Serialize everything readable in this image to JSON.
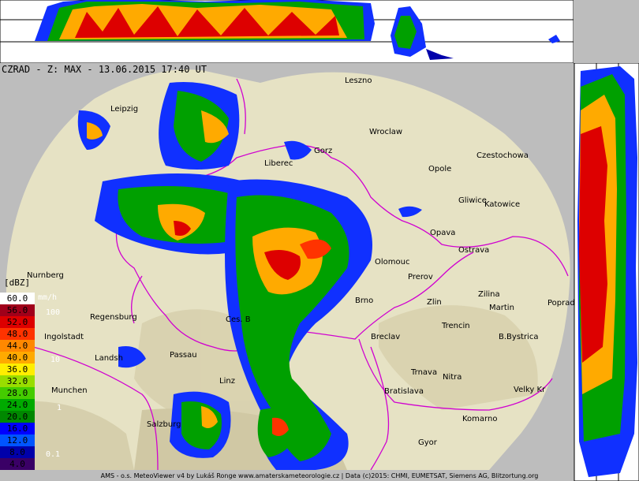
{
  "title": "CZRAD - Z: MAX - 13.06.2015 17:40 UT",
  "legend": {
    "unit": "[dBZ]",
    "rain_unit": "mm/h",
    "levels": [
      {
        "label": "60.0",
        "color": "#ffffff",
        "text": "#000000"
      },
      {
        "label": "56.0",
        "color": "#a0001a",
        "text": "#000000"
      },
      {
        "label": "52.0",
        "color": "#dd0000",
        "text": "#000000"
      },
      {
        "label": "48.0",
        "color": "#ff3300",
        "text": "#000000"
      },
      {
        "label": "44.0",
        "color": "#ff8800",
        "text": "#000000"
      },
      {
        "label": "40.0",
        "color": "#ffaa00",
        "text": "#000000"
      },
      {
        "label": "36.0",
        "color": "#ffee00",
        "text": "#000000"
      },
      {
        "label": "32.0",
        "color": "#99dd00",
        "text": "#000000"
      },
      {
        "label": "28.0",
        "color": "#44cc00",
        "text": "#000000"
      },
      {
        "label": "24.0",
        "color": "#00aa00",
        "text": "#000000"
      },
      {
        "label": "20.0",
        "color": "#008800",
        "text": "#000000"
      },
      {
        "label": "16.0",
        "color": "#0000ff",
        "text": "#000000"
      },
      {
        "label": "12.0",
        "color": "#0055ff",
        "text": "#000000"
      },
      {
        "label": "8.0",
        "color": "#0000aa",
        "text": "#000000"
      },
      {
        "label": "4.0",
        "color": "#3a0066",
        "text": "#000000"
      }
    ],
    "rain_rates": [
      "100",
      "10",
      "1",
      "0.1"
    ]
  },
  "cities": [
    "Leipzig",
    "Leszno",
    "Wroclaw",
    "Gorz",
    "Liberec",
    "Czestochowa",
    "Opole",
    "Gliwice",
    "Katowice",
    "Opava",
    "Ostrava",
    "Olomouc",
    "Prerov",
    "Brno",
    "Zlin",
    "Zilina",
    "Martin",
    "Poprad",
    "Nurnberg",
    "Regensburg",
    "Ingolstadt",
    "Ces. B",
    "Breclav",
    "Trencin",
    "B.Bystrica",
    "Landsh",
    "Passau",
    "Trnava",
    "Nitra",
    "Munchen",
    "Linz",
    "Bratislava",
    "Velky Kr",
    "Salzburg",
    "Komarno",
    "Gyor"
  ],
  "footer": "AMS - o.s. MeteoViewer v4 by Lukáš Ronge www.amaterskameteorologie.cz | Data (c)2015: CHMI, EUMETSAT, Siemens AG, Blitzortung.org",
  "colors": {
    "background": "#bdbdbd",
    "map_land": "#e6e2c4",
    "border": "#d000d0",
    "outside": "#bdbdbd"
  }
}
